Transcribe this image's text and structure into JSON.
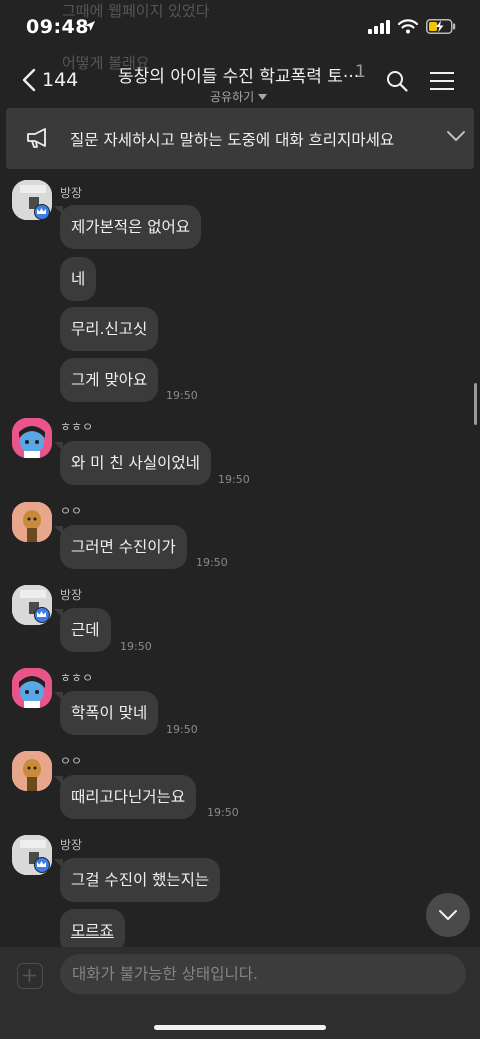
{
  "status_bar": {
    "time": "09:48"
  },
  "ghost_messages": [
    "그때에 웹페이지 있었다",
    "어떻게 볼래요"
  ],
  "header": {
    "back_count": "144",
    "title": "동창의 아이들 수진 학교폭력 토···",
    "member_count": "1",
    "share_label": "공유하기"
  },
  "notice": {
    "text": "질문 자세하시고 말하는 도중에 대화 흐리지마세요"
  },
  "messages": [
    {
      "sender": "방장",
      "texts": [
        "제가본적은 없어요",
        "네",
        "무리.신고싯",
        "그게 맞아요"
      ],
      "time": "19:50"
    },
    {
      "sender": "ㅎㅎㅇ",
      "texts": [
        "와 미 친 사실이었네"
      ],
      "time": "19:50"
    },
    {
      "sender": "ㅇㅇ",
      "texts": [
        "그러면 수진이가"
      ],
      "time": "19:50"
    },
    {
      "sender": "방장",
      "texts": [
        "근데"
      ],
      "time": "19:50"
    },
    {
      "sender": "ㅎㅎㅇ",
      "texts": [
        "학폭이 맞네"
      ],
      "time": "19:50"
    },
    {
      "sender": "ㅇㅇ",
      "texts": [
        "때리고다닌거는요"
      ],
      "time": "19:50"
    },
    {
      "sender": "방장",
      "texts": [
        "그걸 수진이 했는지는",
        "모르죠"
      ],
      "time": ""
    }
  ],
  "input": {
    "placeholder": "대화가 불가능한 상태입니다."
  },
  "colors": {
    "background": "#232323",
    "bubble": "#3b3b3b",
    "owner_badge": "#3e7de8",
    "battery_charging": "#f5c400"
  }
}
